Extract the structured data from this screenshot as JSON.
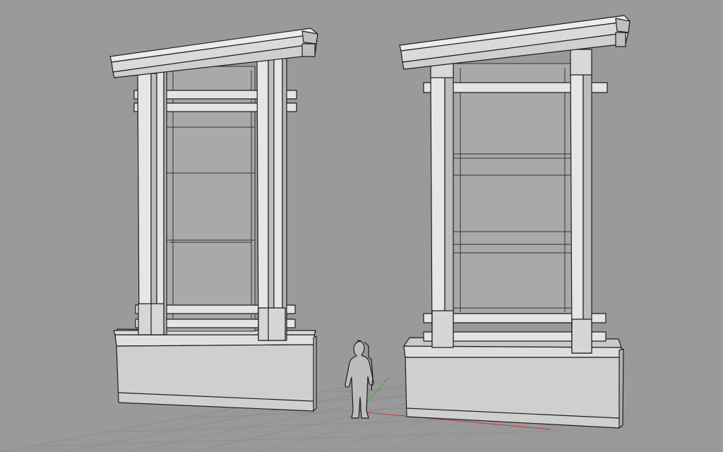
{
  "viewport": {
    "background": "#9a9a9a",
    "grid_color": "#8f8f8f",
    "line_color": "#1e1e1e",
    "face_light": "#e6e6e6",
    "face_mid": "#c8c8c8",
    "face_dark": "#a8a8a8",
    "x_axis_color": "#c83a3a",
    "y_axis_color": "#3aa83a"
  },
  "scene": {
    "objects": [
      {
        "name": "left-monument-sign",
        "kind": "gateway-sign"
      },
      {
        "name": "right-monument-sign",
        "kind": "gateway-sign"
      },
      {
        "name": "human-scale-figure",
        "kind": "scale-figure"
      }
    ],
    "grid": {
      "visible": true
    },
    "world_axes": {
      "visible": true
    }
  }
}
